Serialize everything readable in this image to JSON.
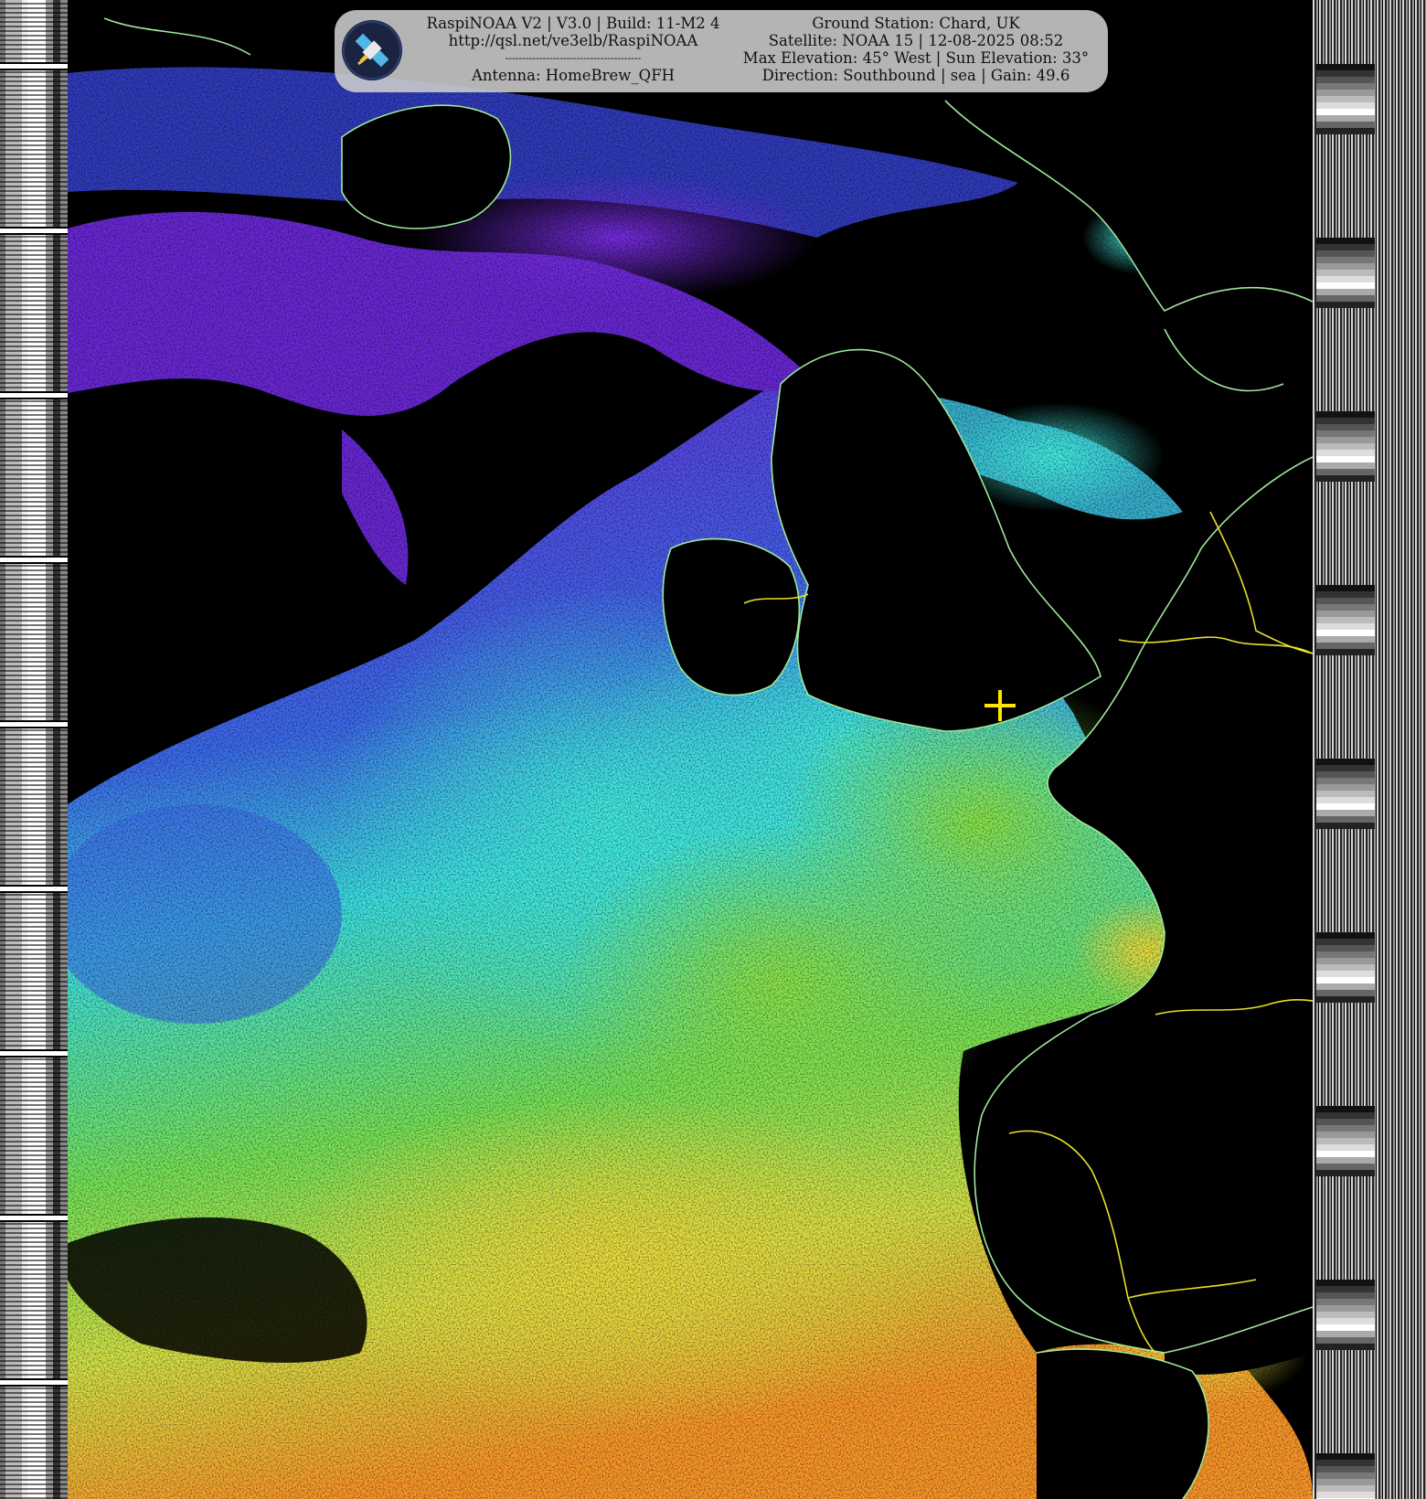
{
  "header": {
    "software": "RaspiNOAA V2 | V3.0 | Build: 11-M2 4",
    "url": "http://qsl.net/ve3elb/RaspiNOAA",
    "divider": "----------------------------------------",
    "antenna": "Antenna: HomeBrew_QFH",
    "ground_station": "Ground Station: Chard, UK",
    "satellite": "Satellite: NOAA 15 | 12-08-2025 08:52",
    "elevation": "Max Elevation: 45° West | Sun Elevation: 33°",
    "direction": "Direction: Southbound | sea | Gain: 49.6"
  },
  "image": {
    "icons": [
      "satellite-logo-icon",
      "ground-station-crosshair-icon"
    ],
    "colors": {
      "background": "#000000",
      "coastline": "#9fe89a",
      "border": "#e8df2a",
      "crosshair": "#ffe600",
      "overlay": "#cdcdcd"
    }
  }
}
